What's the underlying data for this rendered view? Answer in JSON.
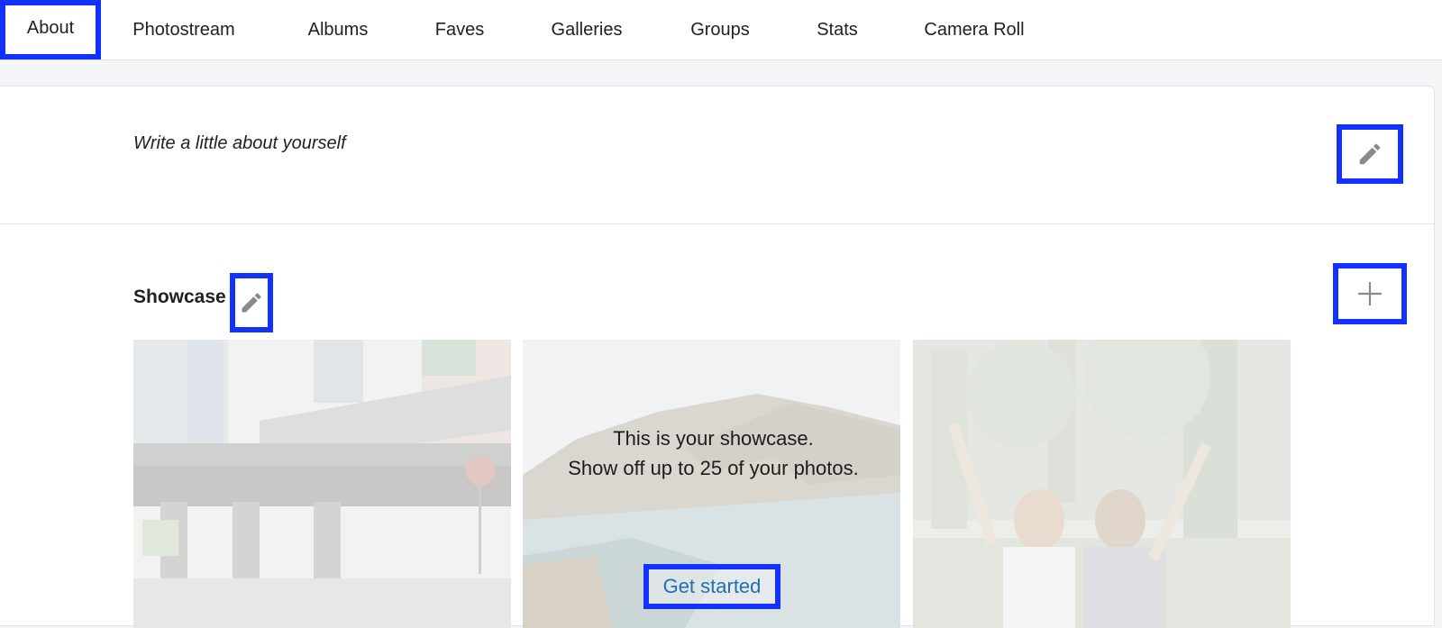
{
  "nav": {
    "tabs": [
      {
        "label": "About"
      },
      {
        "label": "Photostream"
      },
      {
        "label": "Albums"
      },
      {
        "label": "Faves"
      },
      {
        "label": "Galleries"
      },
      {
        "label": "Groups"
      },
      {
        "label": "Stats"
      },
      {
        "label": "Camera Roll"
      }
    ],
    "active_tab": "About"
  },
  "about": {
    "placeholder": "Write a little about yourself",
    "edit_icon": "pencil-icon"
  },
  "showcase": {
    "title": "Showcase",
    "edit_icon": "pencil-icon",
    "add_icon": "plus-icon",
    "line1": "This is your showcase.",
    "line2": "Show off up to 25 of your photos.",
    "cta": "Get started",
    "photos": [
      {
        "subject": "elevated train over city street"
      },
      {
        "subject": "rocky coastline with ocean"
      },
      {
        "subject": "two girls with raised arms in park"
      }
    ]
  },
  "colors": {
    "highlight": "#1432ff",
    "link": "#1f6fb5"
  }
}
